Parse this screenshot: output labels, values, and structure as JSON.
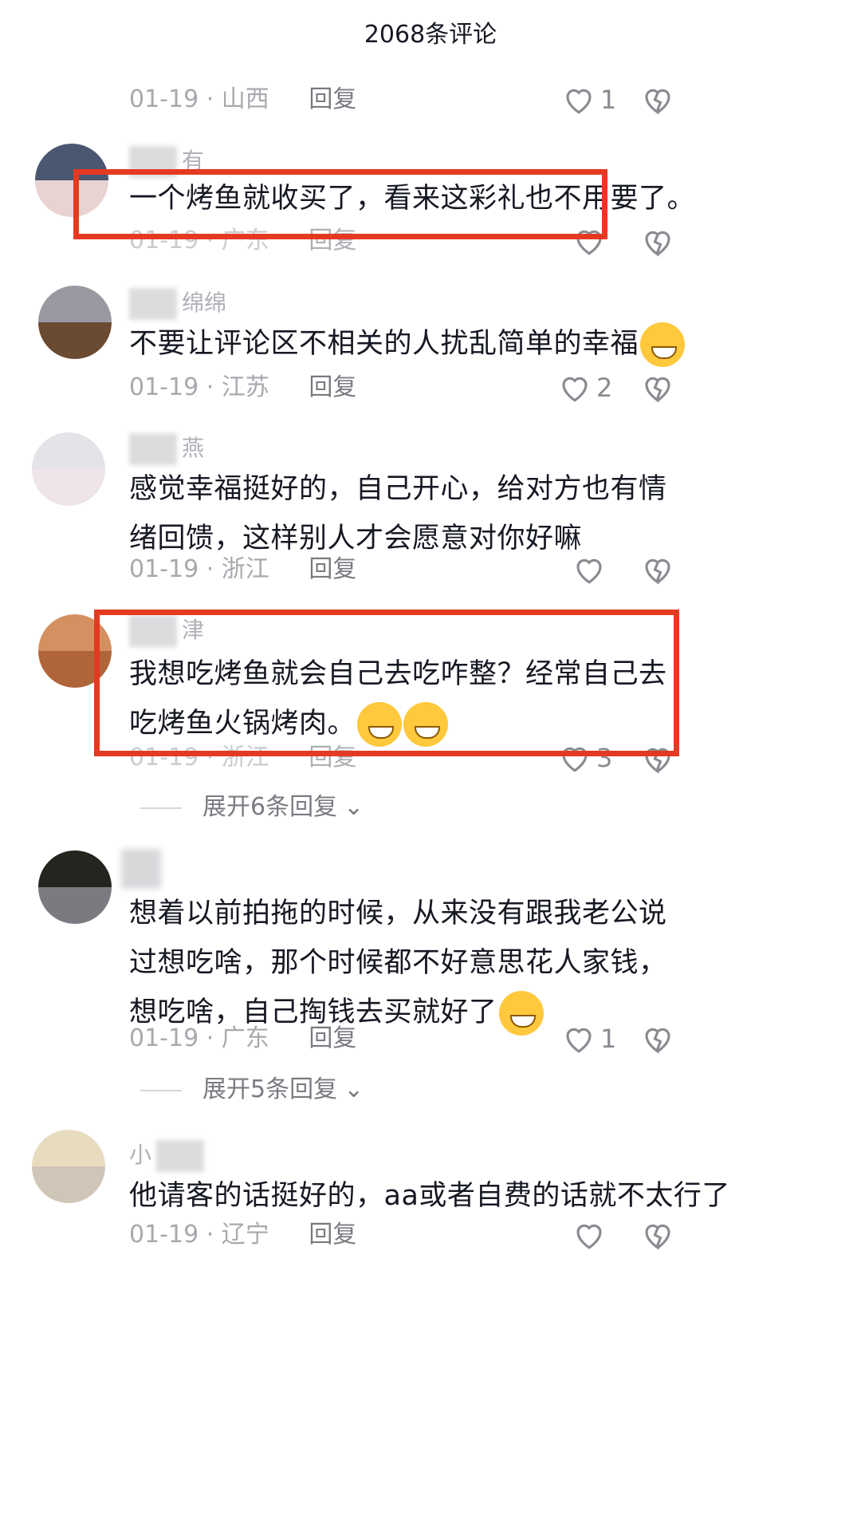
{
  "header": {
    "title": "2068条评论"
  },
  "comments": [
    {
      "username": "",
      "text": "",
      "date": "01-19",
      "location": "山西",
      "reply": "回复",
      "likes": "1"
    },
    {
      "username": "有",
      "text": "一个烤鱼就收买了，看来这彩礼也不用要了。",
      "date": "01-19",
      "location": "广东",
      "reply": "回复",
      "likes": ""
    },
    {
      "username": "绵绵",
      "text": "不要让评论区不相关的人扰乱简单的幸福",
      "date": "01-19",
      "location": "江苏",
      "reply": "回复",
      "likes": "2"
    },
    {
      "username": "燕",
      "text": "感觉幸福挺好的，自己开心，给对方也有情绪回馈，这样别人才会愿意对你好嘛",
      "date": "01-19",
      "location": "浙江",
      "reply": "回复",
      "likes": ""
    },
    {
      "username": "津",
      "text": "我想吃烤鱼就会自己去吃咋整？经常自己去吃烤鱼火锅烤肉。",
      "date": "01-19",
      "location": "浙江",
      "reply": "回复",
      "likes": "3"
    },
    {
      "username": "",
      "text": "想着以前拍拖的时候，从来没有跟我老公说过想吃啥，那个时候都不好意思花人家钱，想吃啥，自己掏钱去买就好了",
      "date": "01-19",
      "location": "广东",
      "reply": "回复",
      "likes": "1"
    },
    {
      "username": "小",
      "text": "他请客的话挺好的，aa或者自费的话就不太行了",
      "date": "01-19",
      "location": "辽宁",
      "reply": "回复",
      "likes": ""
    }
  ],
  "expanders": [
    "展开6条回复",
    "展开5条回复"
  ],
  "colors": {
    "highlight": "#e53a22",
    "meta": "#a8a9ae",
    "text": "#161823"
  },
  "icons": {
    "like": "heart-outline-icon",
    "dislike": "broken-heart-icon",
    "expand": "chevron-down-icon"
  }
}
